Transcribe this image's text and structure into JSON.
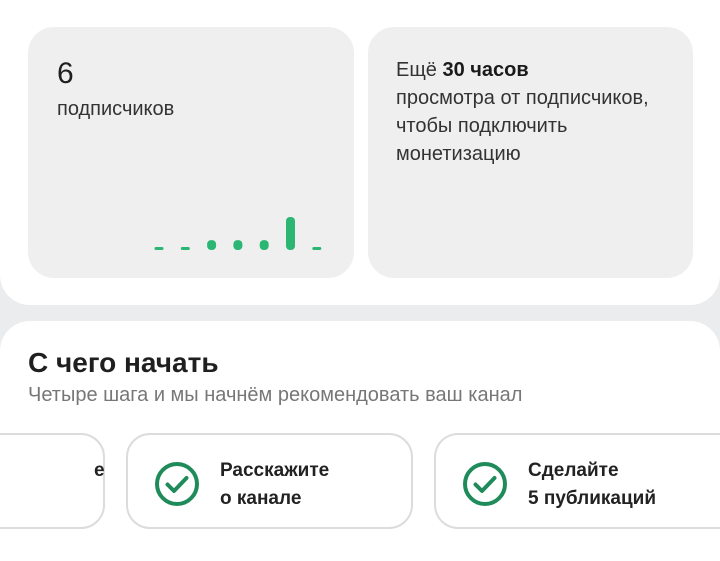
{
  "stats": {
    "subscribers_count": "6",
    "subscribers_label": "подписчиков",
    "sparkline": [
      0.05,
      0.05,
      0.3,
      0.3,
      0.3,
      1.0,
      0.05
    ],
    "sparkline_color": "#2bb673",
    "monetization_prefix": "Ещё ",
    "monetization_bold": "30 часов",
    "monetization_rest": "просмотра от подписчиков, чтобы подключить монетизацию"
  },
  "start": {
    "title": "С чего начать",
    "subtitle": "Четыре шага и мы начнём рекомендовать ваш канал",
    "steps": [
      {
        "line1": "е",
        "line2": "",
        "icon": "check-circle-icon"
      },
      {
        "line1": "Расскажите",
        "line2": "о канале",
        "icon": "check-circle-icon"
      },
      {
        "line1": "Сделайте",
        "line2": "5 публикаций",
        "icon": "check-circle-icon"
      }
    ],
    "check_color": "#1f8a5a"
  }
}
